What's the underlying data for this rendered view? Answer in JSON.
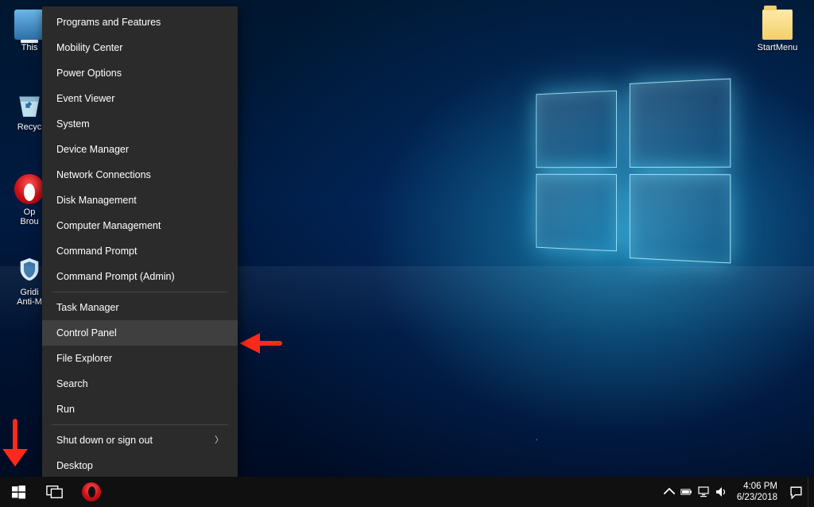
{
  "desktop_icons": {
    "this_pc": "This",
    "recycle_bin": "Recyc",
    "opera": "Op\nBrou",
    "gridinsoft": "Gridi\nAnti-M",
    "start_menu_folder": "StartMenu"
  },
  "winx_menu": {
    "items_group1": [
      "Programs and Features",
      "Mobility Center",
      "Power Options",
      "Event Viewer",
      "System",
      "Device Manager",
      "Network Connections",
      "Disk Management",
      "Computer Management",
      "Command Prompt",
      "Command Prompt (Admin)"
    ],
    "items_group2": [
      "Task Manager",
      "Control Panel",
      "File Explorer",
      "Search",
      "Run"
    ],
    "items_group3": [
      "Shut down or sign out",
      "Desktop"
    ],
    "hovered_index_group2": 1
  },
  "tray": {
    "time": "4:06 PM",
    "date": "6/23/2018"
  }
}
